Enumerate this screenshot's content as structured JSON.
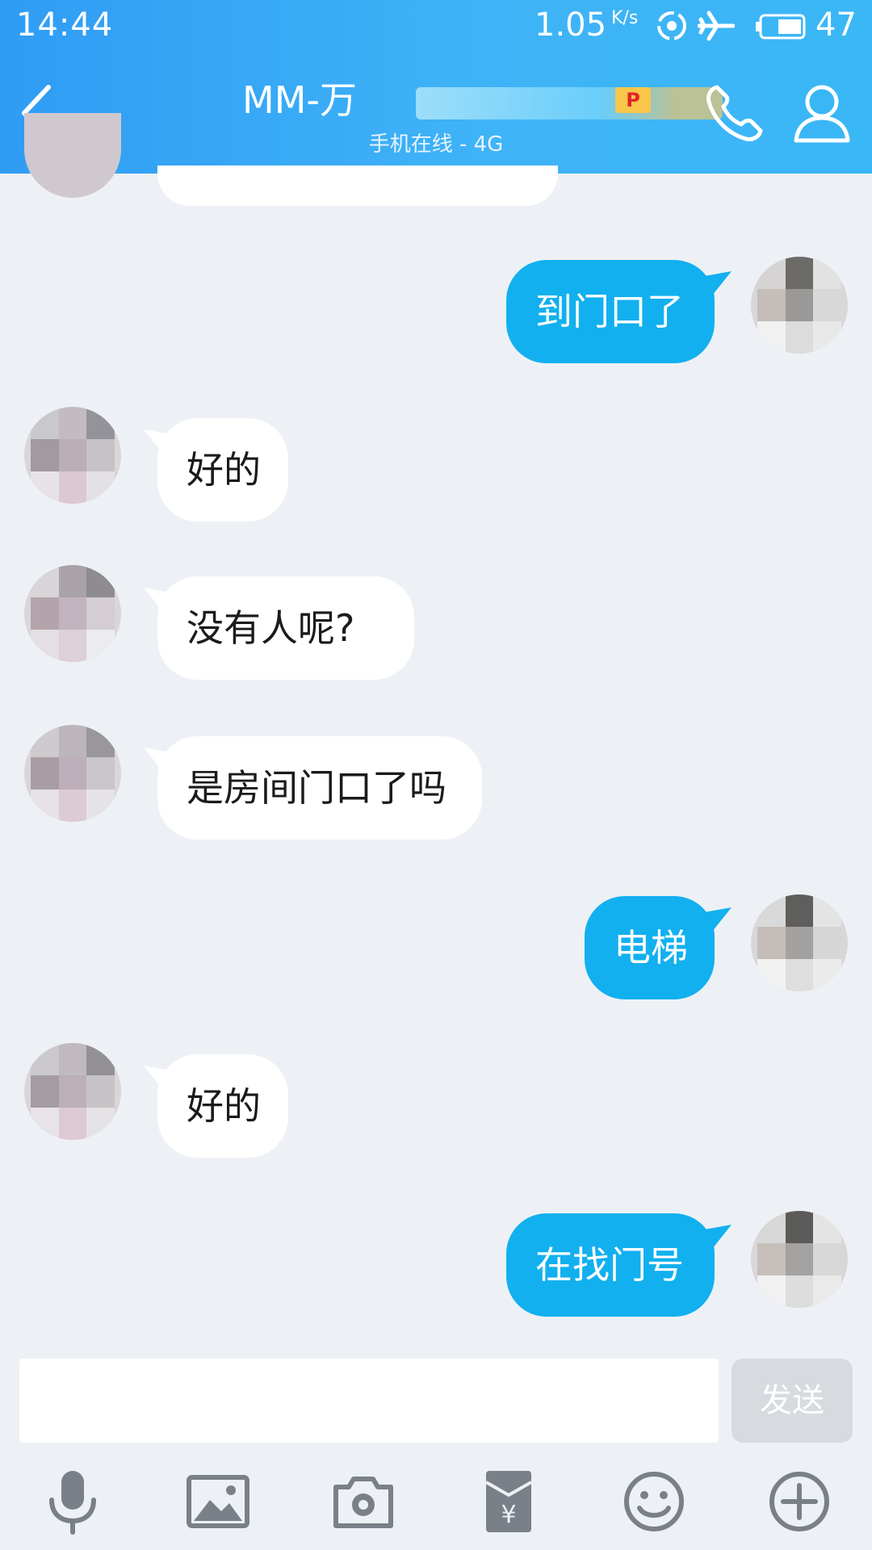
{
  "status_bar": {
    "time": "14:44",
    "net_speed": "1.05",
    "net_unit": "K/s",
    "battery": "47"
  },
  "header": {
    "title": "MM-万",
    "vip_badge": "P",
    "subtitle": "手机在线 - 4G",
    "back_icon": "chevron-left-icon",
    "call_icon": "phone-icon",
    "profile_icon": "user-icon"
  },
  "messages": [
    {
      "side": "out",
      "text": "到门口了"
    },
    {
      "side": "in",
      "text": "好的"
    },
    {
      "side": "in",
      "text": "没有人呢?"
    },
    {
      "side": "in",
      "text": "是房间门口了吗"
    },
    {
      "side": "out",
      "text": "电梯"
    },
    {
      "side": "in",
      "text": "好的"
    },
    {
      "side": "out",
      "text": "在找门号"
    }
  ],
  "composer": {
    "input_value": "",
    "send_label": "发送"
  },
  "toolbar": [
    "mic-icon",
    "image-icon",
    "camera-icon",
    "red-packet-icon",
    "emoji-icon",
    "plus-icon"
  ],
  "colors": {
    "header": "#3aa8f5",
    "outgoing_bubble": "#12b0ef",
    "incoming_bubble": "#ffffff",
    "background": "#edf1f5"
  }
}
